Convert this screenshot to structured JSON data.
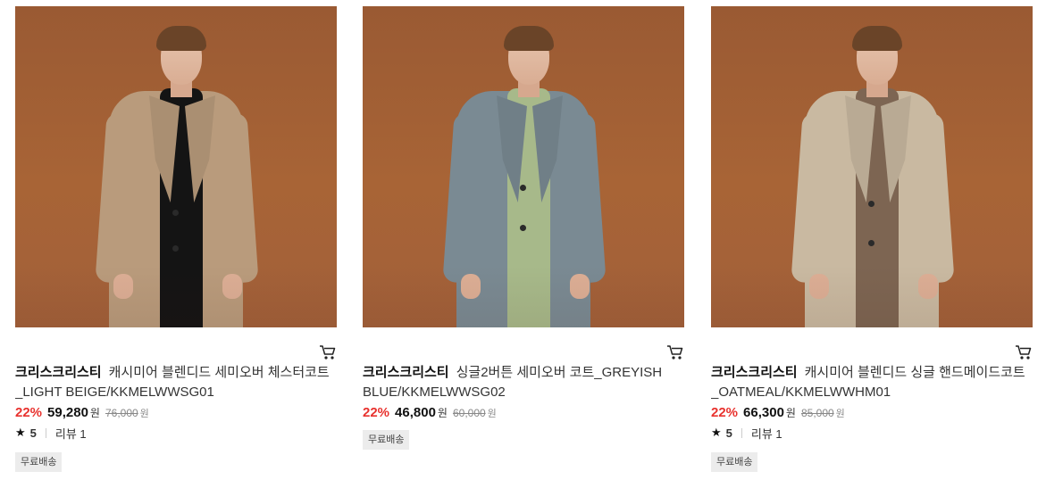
{
  "products": [
    {
      "brand": "크리스크리스티",
      "name": "캐시미어 블렌디드 세미오버 체스터코트_LIGHT BEIGE/KKMELWWSG01",
      "discount": "22%",
      "price": "59,280",
      "currency": "원",
      "original_price": "76,000",
      "rating": "5",
      "review": "리뷰 1",
      "tag": "무료배송",
      "coat_color": "#b99b7c",
      "inner_color": "#141414",
      "image_icon": "beige-chester-coat-model"
    },
    {
      "brand": "크리스크리스티",
      "name": "싱글2버튼 세미오버 코트_GREYISH BLUE/KKMELWWSG02",
      "discount": "22%",
      "price": "46,800",
      "currency": "원",
      "original_price": "60,000",
      "rating": null,
      "review": null,
      "tag": "무료배송",
      "coat_color": "#7a8a93",
      "inner_color": "#a7b98a",
      "image_icon": "greyish-blue-coat-model"
    },
    {
      "brand": "크리스크리스티",
      "name": "캐시미어 블렌디드 싱글 핸드메이드코트_OATMEAL/KKMELWWHM01",
      "discount": "22%",
      "price": "66,300",
      "currency": "원",
      "original_price": "85,000",
      "rating": "5",
      "review": "리뷰 1",
      "tag": "무료배송",
      "coat_color": "#c9b9a1",
      "inner_color": "#7d6552",
      "image_icon": "oatmeal-handmade-coat-model"
    }
  ],
  "colors": {
    "background_photo": "#a4613a",
    "discount": "#e8322e",
    "tag_bg": "#ececec"
  }
}
